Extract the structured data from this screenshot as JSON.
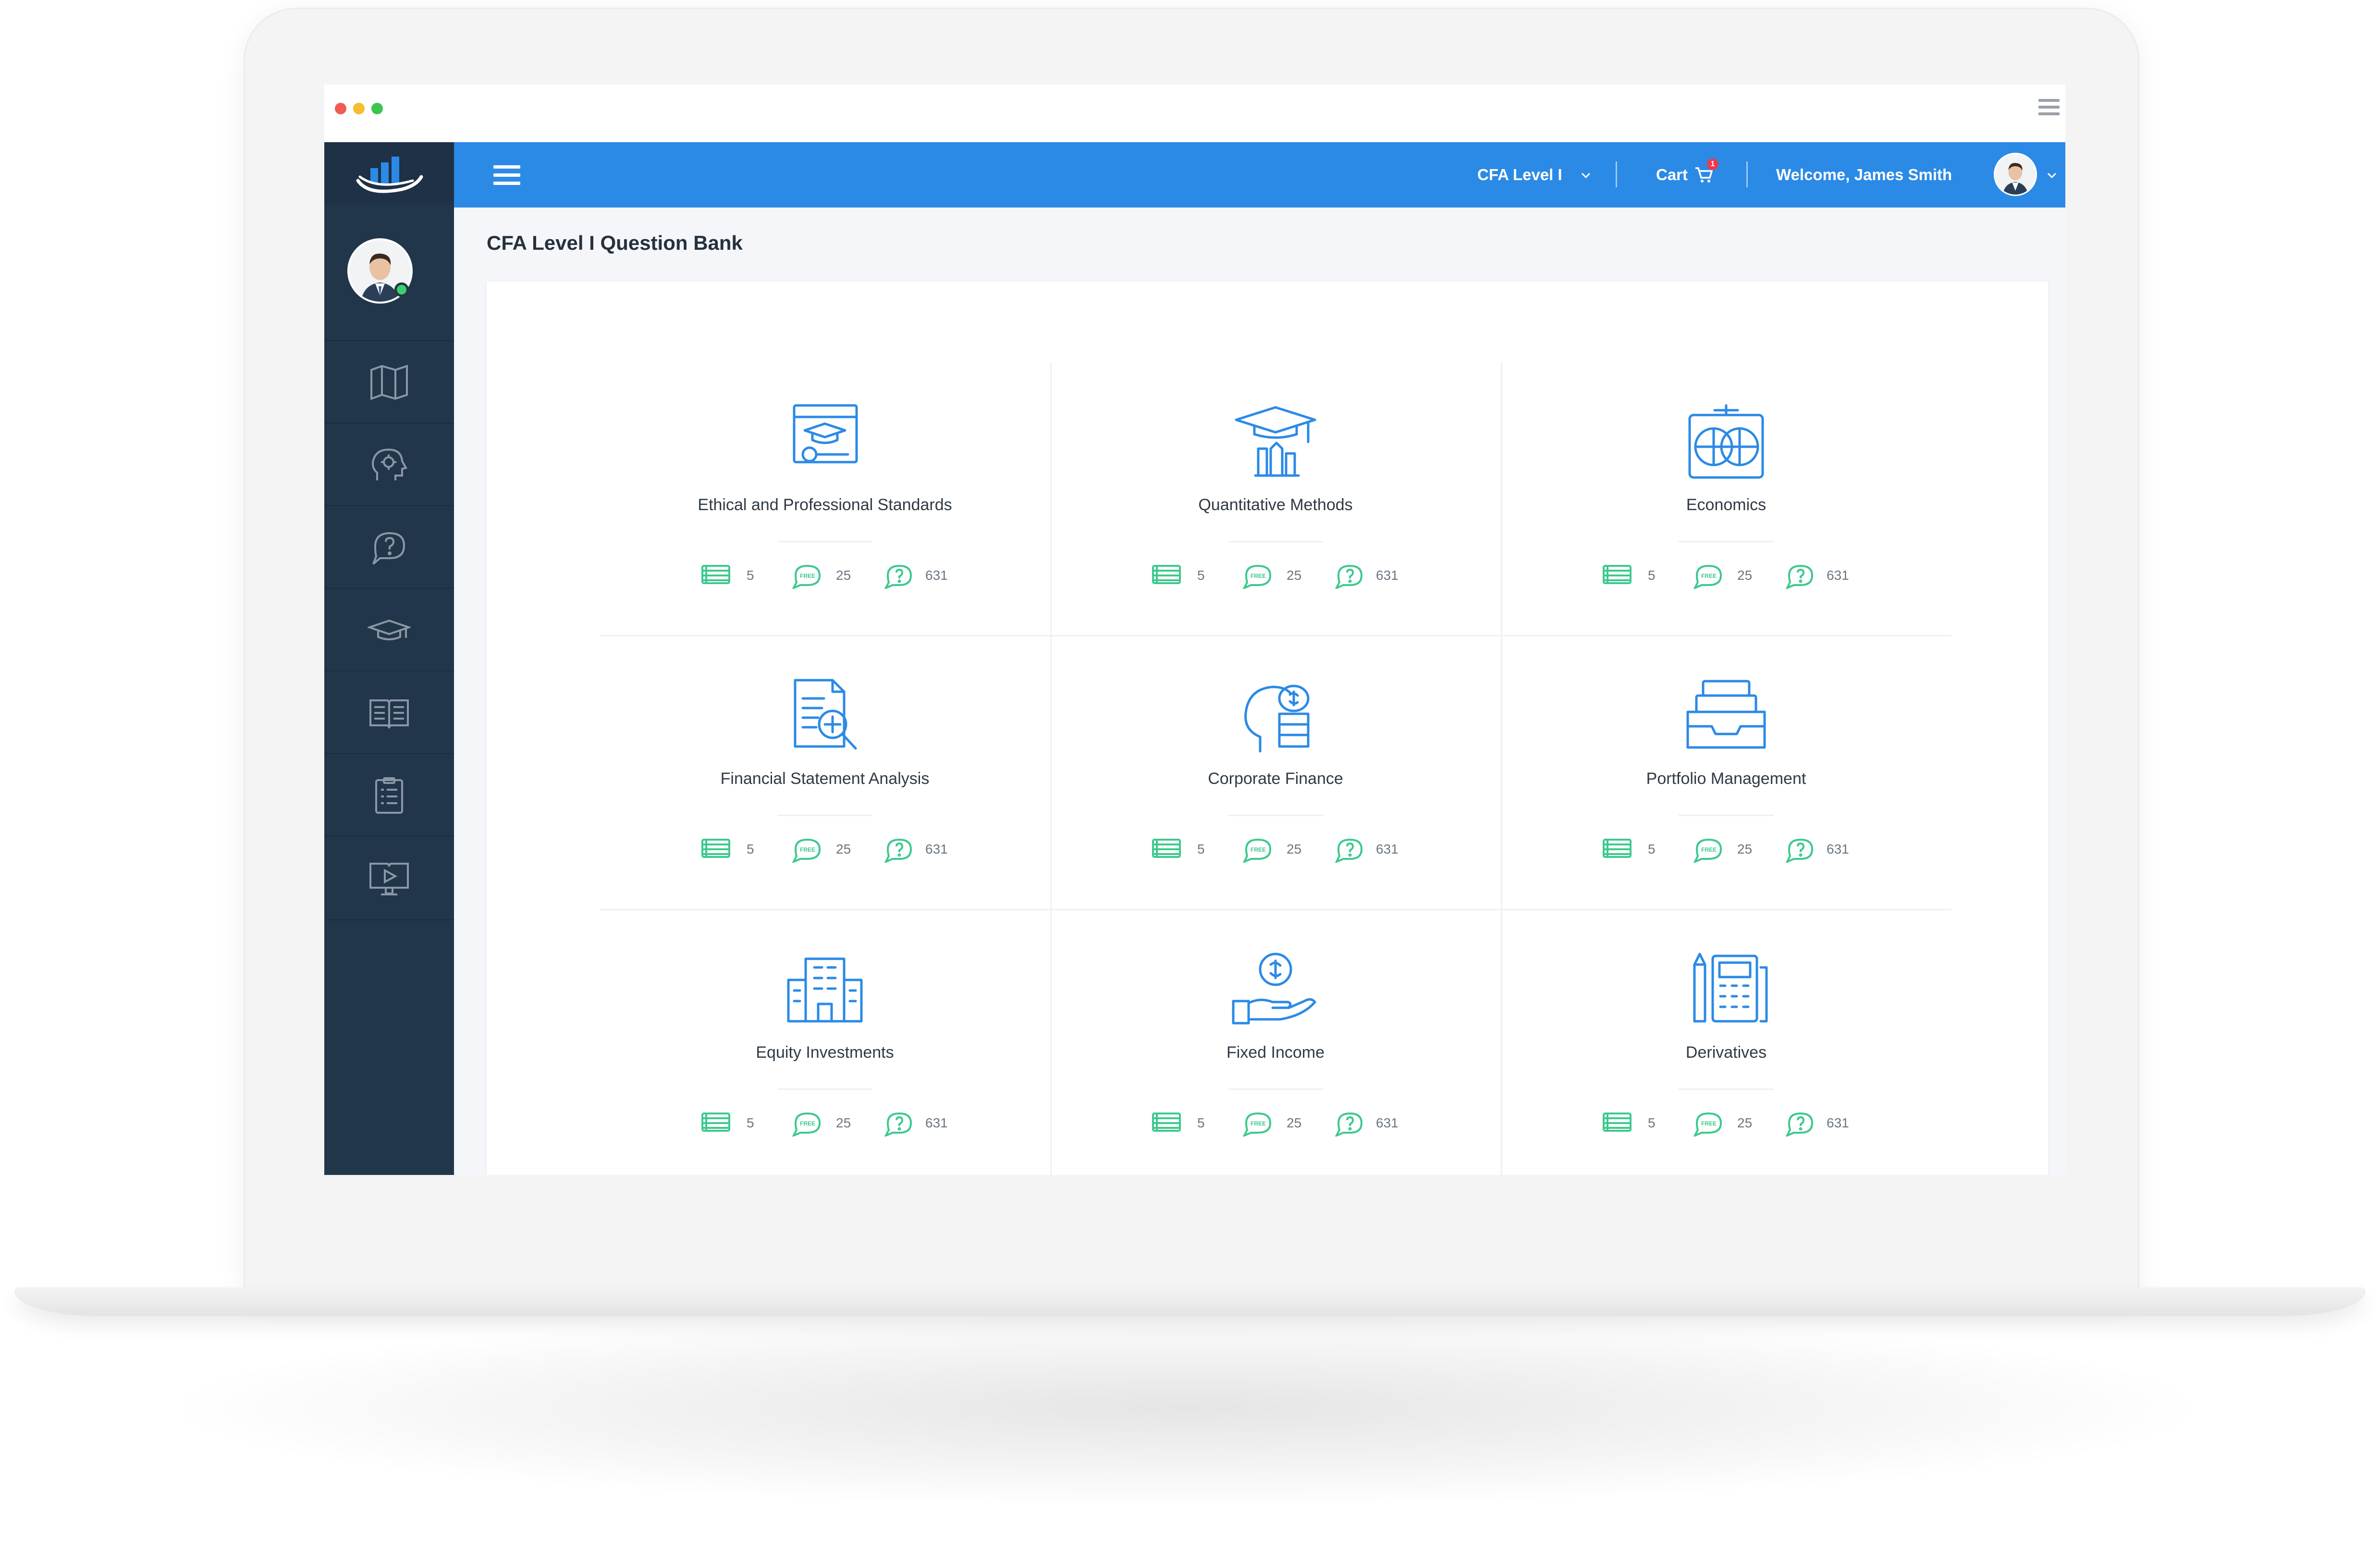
{
  "header": {
    "level_selector": "CFA Level I",
    "cart_label": "Cart",
    "cart_count": "1",
    "welcome": "Welcome, James Smith"
  },
  "page": {
    "title": "CFA Level I Question Bank"
  },
  "sidebar": {
    "items": [
      {
        "icon": "map-book-icon"
      },
      {
        "icon": "gear-head-icon"
      },
      {
        "icon": "question-chat-icon"
      },
      {
        "icon": "graduation-cap-icon"
      },
      {
        "icon": "open-book-icon"
      },
      {
        "icon": "checklist-icon"
      },
      {
        "icon": "video-book-icon"
      }
    ]
  },
  "colors": {
    "topbar": "#2b8ae6",
    "sidebar": "#22364b",
    "icon_blue": "#2b8ae6",
    "stat_green": "#3dc98c"
  },
  "subjects": [
    {
      "name": "Ethical and Professional Standards",
      "icon": "certificate-screen-icon",
      "notes": "5",
      "free": "25",
      "questions": "631"
    },
    {
      "name": "Quantitative Methods",
      "icon": "graduation-tools-icon",
      "notes": "5",
      "free": "25",
      "questions": "631"
    },
    {
      "name": "Economics",
      "icon": "globe-icon",
      "notes": "5",
      "free": "25",
      "questions": "631"
    },
    {
      "name": "Financial Statement Analysis",
      "icon": "document-search-icon",
      "notes": "5",
      "free": "25",
      "questions": "631"
    },
    {
      "name": "Corporate Finance",
      "icon": "head-coins-icon",
      "notes": "5",
      "free": "25",
      "questions": "631"
    },
    {
      "name": "Portfolio Management",
      "icon": "file-tray-icon",
      "notes": "5",
      "free": "25",
      "questions": "631"
    },
    {
      "name": "Equity Investments",
      "icon": "building-icon",
      "notes": "5",
      "free": "25",
      "questions": "631"
    },
    {
      "name": "Fixed Income",
      "icon": "hand-coin-icon",
      "notes": "5",
      "free": "25",
      "questions": "631"
    },
    {
      "name": "Derivatives",
      "icon": "calculator-tools-icon",
      "notes": "5",
      "free": "25",
      "questions": "631"
    }
  ],
  "free_badge": "FREE"
}
